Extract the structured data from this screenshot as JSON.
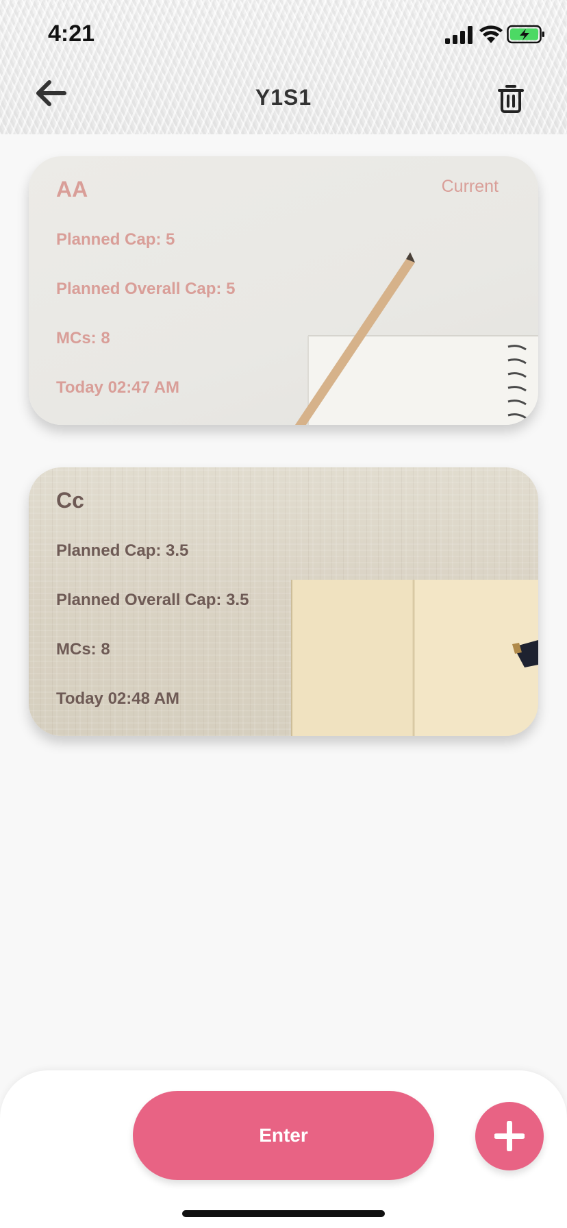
{
  "status_bar": {
    "time": "4:21"
  },
  "header": {
    "title": "Y1S1"
  },
  "cards": [
    {
      "title": "AA",
      "badge": "Current",
      "planned_cap": "Planned Cap: 5",
      "planned_overall_cap": "Planned Overall Cap: 5",
      "mcs": "MCs: 8",
      "timestamp": "Today 02:47 AM"
    },
    {
      "title": "Cc",
      "planned_cap": "Planned Cap: 3.5",
      "planned_overall_cap": "Planned Overall Cap: 3.5",
      "mcs": "MCs: 8",
      "timestamp": "Today 02:48 AM"
    }
  ],
  "bottom": {
    "enter_label": "Enter",
    "add_icon": "plus-icon"
  },
  "colors": {
    "accent": "#e86384",
    "card1_text": "#d99e98",
    "card2_text": "#6e5a55",
    "background": "#f8f8f8"
  }
}
